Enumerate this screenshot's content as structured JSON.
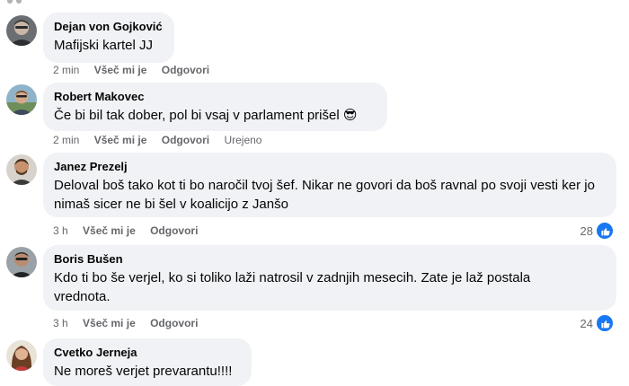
{
  "comments": [
    {
      "author": "Dejan von Gojković",
      "text": "Mafijski kartel JJ",
      "time": "2 min",
      "like_label": "Všeč mi je",
      "reply_label": "Odgovori"
    },
    {
      "author": "Robert Makovec",
      "text": "Če bi bil tak dober, pol bi vsaj v parlament prišel",
      "emoji": "😎",
      "time": "2 min",
      "like_label": "Všeč mi je",
      "reply_label": "Odgovori",
      "edited_label": "Urejeno"
    },
    {
      "author": "Janez Prezelj",
      "text": "Deloval boš tako kot ti bo naročil tvoj šef. Nikar ne govori da boš ravnal po svoji vesti ker jo nimaš sicer ne bi šel v koalicijo z Janšo",
      "time": "3 h",
      "like_label": "Všeč mi je",
      "reply_label": "Odgovori",
      "reactions": "28"
    },
    {
      "author": "Boris Bušen",
      "text": "Kdo ti bo še verjel, ko si toliko laži natrosil v zadnjih mesecih. Zate je laž postala vrednota.",
      "time": "3 h",
      "like_label": "Všeč mi je",
      "reply_label": "Odgovori",
      "reactions": "24"
    },
    {
      "author": "Cvetko Jerneja",
      "text": "Ne moreš verjet prevarantu!!!!"
    }
  ],
  "icons": {
    "like": "thumbs-up-icon"
  },
  "colors": {
    "bubble": "#f0f2f5",
    "meta": "#65676b",
    "like_badge": "#1877f2"
  }
}
